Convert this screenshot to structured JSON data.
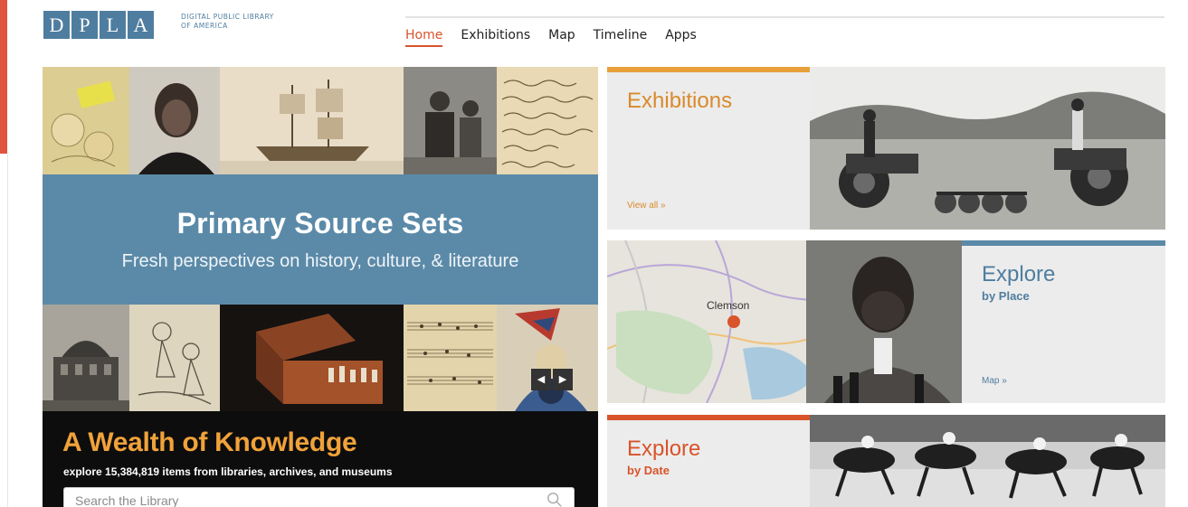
{
  "header": {
    "logo_letters": [
      "D",
      "P",
      "L",
      "A"
    ],
    "logo_subtitle_line1": "DIGITAL PUBLIC LIBRARY",
    "logo_subtitle_line2": "OF AMERICA",
    "nav": [
      {
        "label": "Home",
        "active": true
      },
      {
        "label": "Exhibitions",
        "active": false
      },
      {
        "label": "Map",
        "active": false
      },
      {
        "label": "Timeline",
        "active": false
      },
      {
        "label": "Apps",
        "active": false
      }
    ]
  },
  "feature": {
    "title": "Primary Source Sets",
    "subtitle": "Fresh perspectives on history, culture, & literature",
    "prev_glyph": "◀",
    "next_glyph": "▶"
  },
  "wealth": {
    "title": "A Wealth of Knowledge",
    "subtitle": "explore 15,384,819 items from libraries, archives, and museums",
    "search_placeholder": "Search the Library"
  },
  "cards": {
    "exhibitions": {
      "title": "Exhibitions",
      "link": "View all »",
      "accent": "#e8a13a",
      "title_color": "#d98a2c"
    },
    "place": {
      "title": "Explore",
      "subtitle": "by Place",
      "link": "Map »",
      "accent": "#5b8aa8",
      "title_color": "#4f7d9f",
      "map_label": "Clemson"
    },
    "date": {
      "title": "Explore",
      "subtitle": "by Date",
      "accent": "#d9532b",
      "title_color": "#d9532b"
    }
  },
  "colors": {
    "brand_blue": "#4f7d9f",
    "brand_orange": "#d9532b",
    "gold": "#f0a23a",
    "side_red": "#e0533d"
  }
}
